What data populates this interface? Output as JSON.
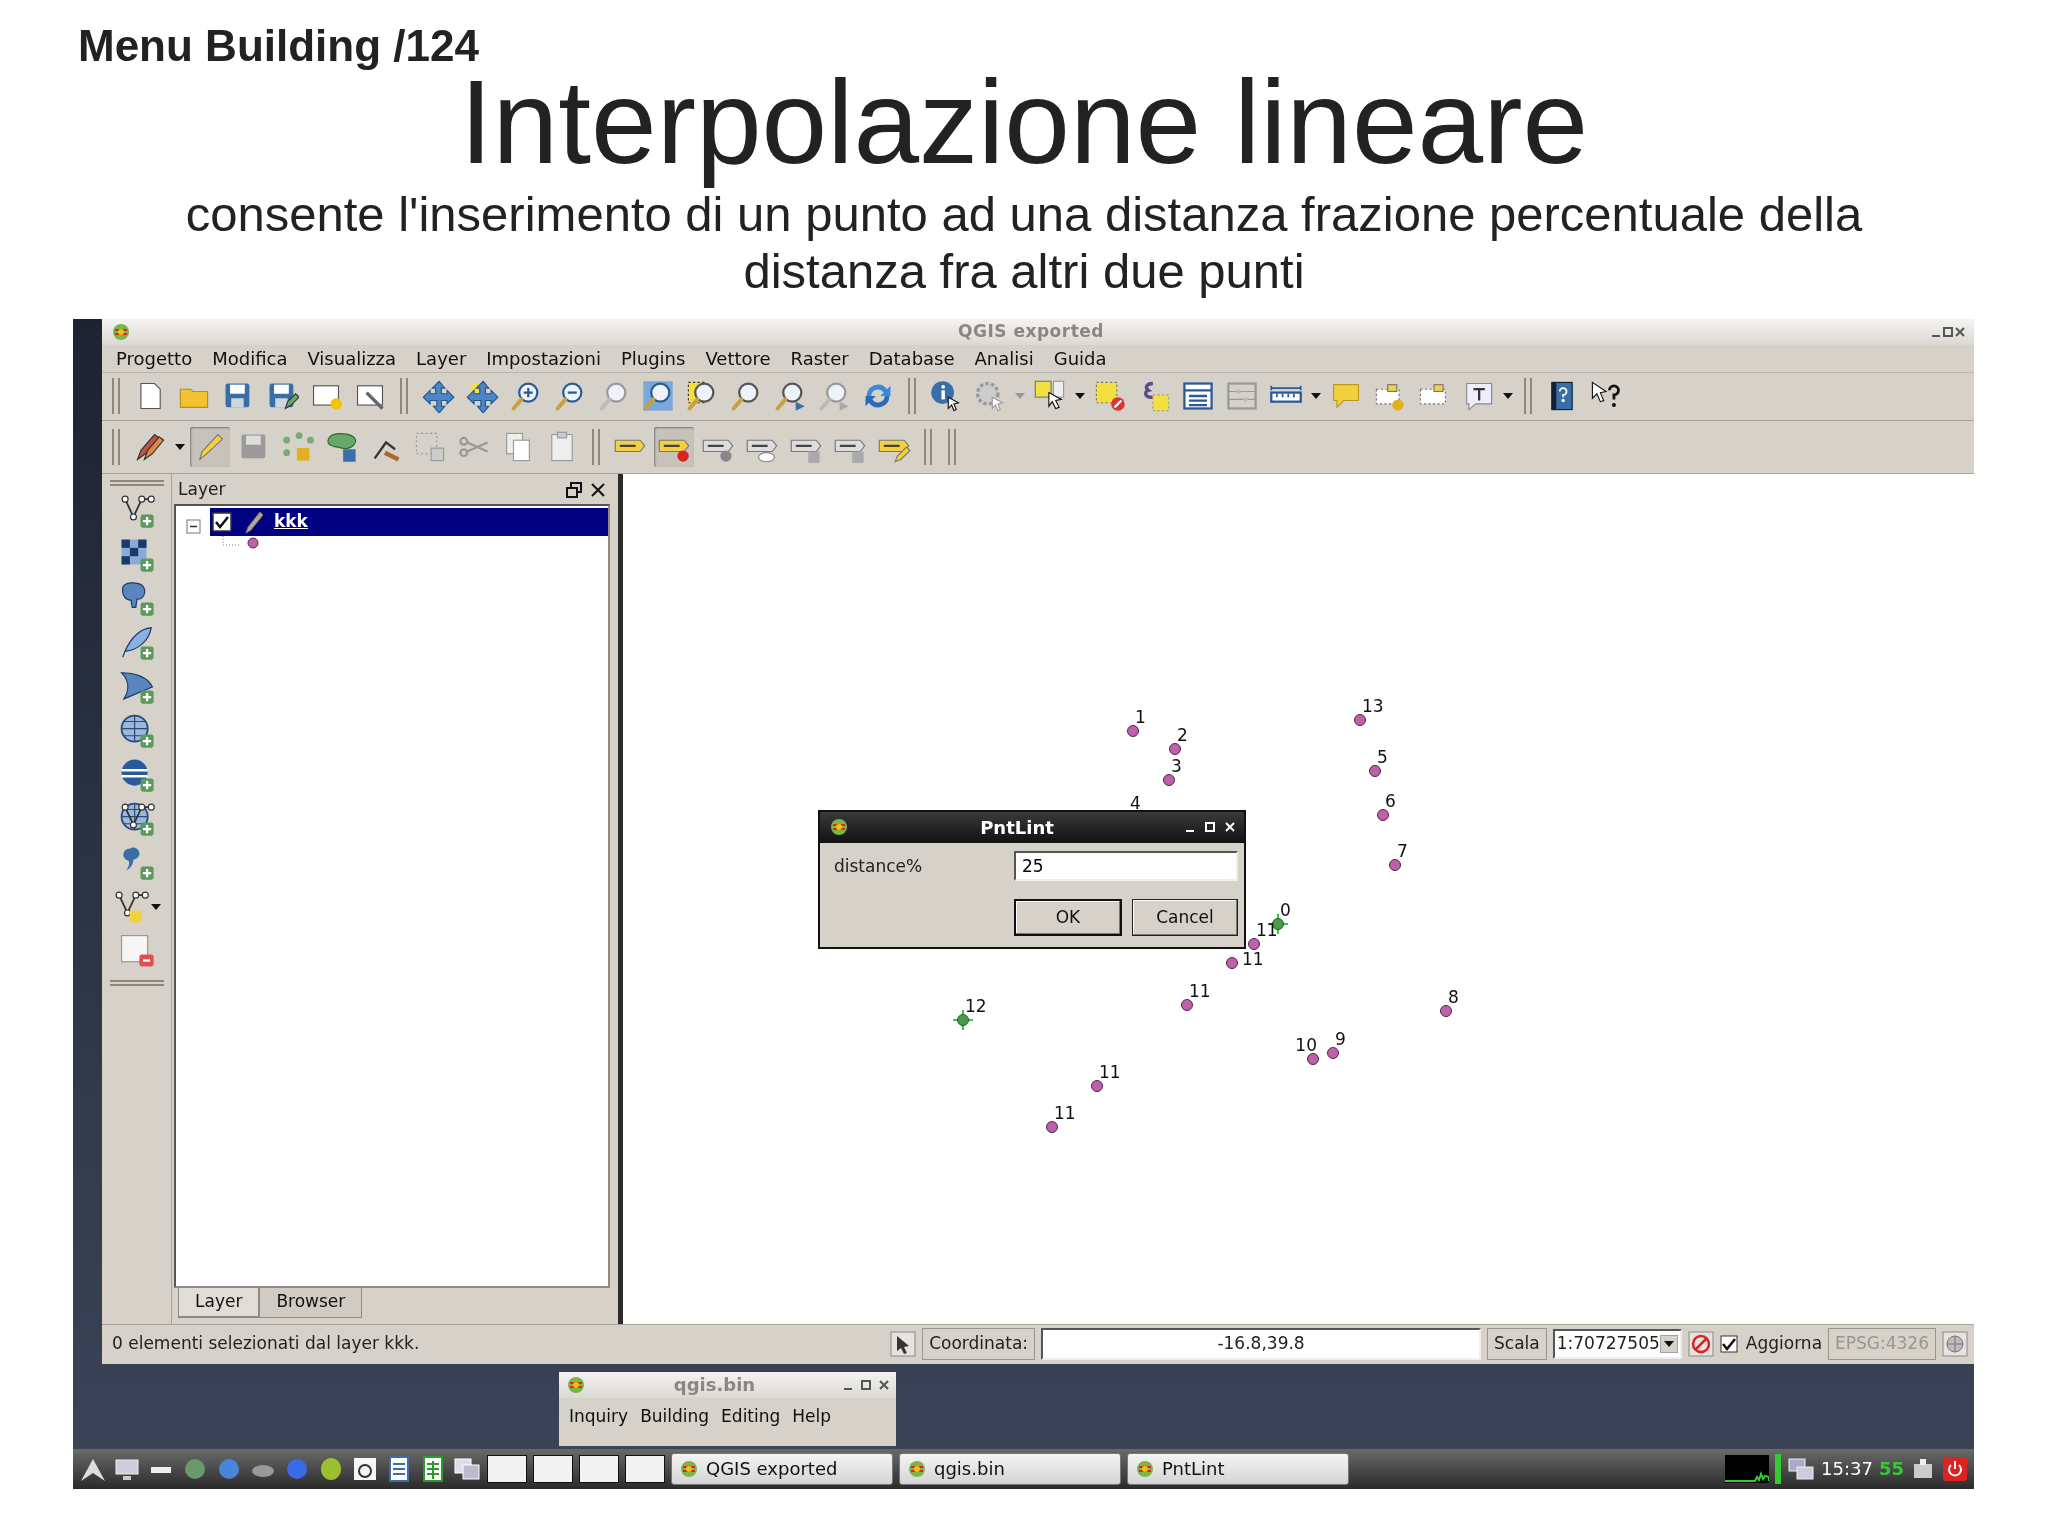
{
  "slide": {
    "header": "Menu Building /124",
    "title": "Interpolazione lineare",
    "subtitle": "consente l'inserimento di un punto ad una distanza frazione percentuale della distanza fra altri due punti"
  },
  "window": {
    "title": "QGIS exported"
  },
  "menu": [
    "Progetto",
    "Modifica",
    "Visualizza",
    "Layer",
    "Impostazioni",
    "Plugins",
    "Vettore",
    "Raster",
    "Database",
    "Analisi",
    "Guida"
  ],
  "layers_panel": {
    "title": "Layer",
    "layers": [
      {
        "name": "kkk",
        "checked": true,
        "selected": true,
        "expanded": true
      }
    ],
    "tabs": [
      {
        "label": "Layer",
        "selected": true
      },
      {
        "label": "Browser",
        "selected": false
      }
    ]
  },
  "map": {
    "points": [
      {
        "label": "1",
        "selected": false
      },
      {
        "label": "13",
        "selected": false
      },
      {
        "label": "2",
        "selected": false
      },
      {
        "label": "3",
        "selected": false
      },
      {
        "label": "5",
        "selected": false
      },
      {
        "label": "4",
        "selected": false
      },
      {
        "label": "6",
        "selected": false
      },
      {
        "label": "7",
        "selected": false
      },
      {
        "label": "0",
        "selected": true
      },
      {
        "label": "11",
        "selected": false
      },
      {
        "label": "11",
        "selected": false
      },
      {
        "label": "12",
        "selected": true
      },
      {
        "label": "11",
        "selected": false
      },
      {
        "label": "8",
        "selected": false
      },
      {
        "label": "10",
        "selected": false
      },
      {
        "label": "9",
        "selected": false
      },
      {
        "label": "11",
        "selected": false
      },
      {
        "label": "11",
        "selected": false
      }
    ]
  },
  "dialog": {
    "title": "PntLint",
    "field_label": "distance%",
    "value": "25",
    "buttons": [
      "OK",
      "Cancel"
    ]
  },
  "status_bar": {
    "message": "0 elementi selezionati dal layer kkk.",
    "coordinate_label": "Coordinata:",
    "coordinate": "-16.8,39.8",
    "scale_label": "Scala",
    "scale": "1:70727505",
    "render_label": "Aggiorna",
    "render_checked": true,
    "crs": "EPSG:4326"
  },
  "plugin_window": {
    "title": "qgis.bin",
    "menu": [
      "Inquiry",
      "Building",
      "Editing",
      "Help"
    ]
  },
  "taskbar": {
    "tasks": [
      {
        "label": "QGIS exported"
      },
      {
        "label": "qgis.bin"
      },
      {
        "label": "PntLint"
      }
    ],
    "clock": "15:37",
    "indicator": "55"
  }
}
